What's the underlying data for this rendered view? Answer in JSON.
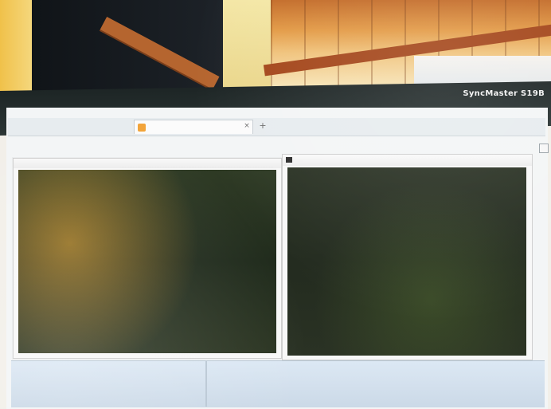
{
  "scene": {
    "brand_text": "SyncMaster S19B",
    "accent_colors": {
      "terminal_text": "#f8e79a",
      "monitor_bezel": "#1d2525",
      "background_roof": "#e39a45"
    }
  },
  "browser": {
    "tab_title": "",
    "tab_close_label": "×",
    "new_tab_label": "+"
  },
  "left_window": {
    "title": "",
    "terminal_lines": [
      "",
      "",
      "",
      "",
      "",
      "",
      "",
      "",
      "",
      "",
      "",
      "",
      "",
      ""
    ]
  },
  "right_window": {
    "title": "",
    "icon": "command-prompt-icon",
    "terminal_lines": [
      "",
      "",
      "",
      "",
      "",
      "",
      "",
      "",
      "",
      "",
      "",
      "",
      "",
      "",
      "",
      ""
    ]
  },
  "taskbar": {
    "button_1": "",
    "button_2": ""
  }
}
